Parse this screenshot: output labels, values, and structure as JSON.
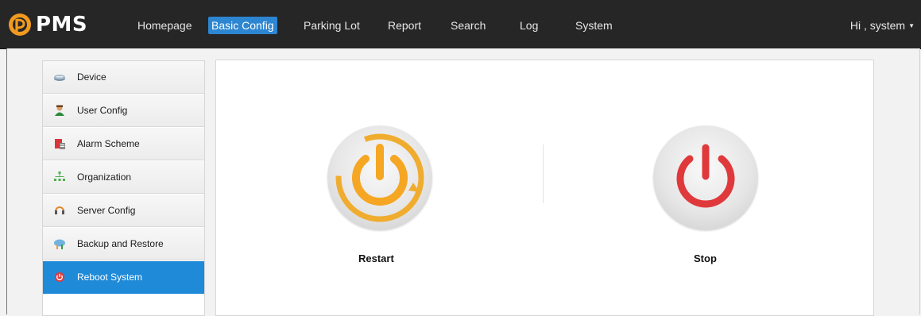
{
  "app": {
    "logo_text": "PMS"
  },
  "nav": {
    "items": [
      {
        "label": "Homepage"
      },
      {
        "label": "Basic Config"
      },
      {
        "label": "Parking Lot"
      },
      {
        "label": "Report"
      },
      {
        "label": "Search"
      },
      {
        "label": "Log"
      },
      {
        "label": "System"
      }
    ],
    "active": "Basic Config",
    "user_greeting": "Hi , system",
    "user_menu_icon": "caret-down-icon"
  },
  "sidebar": {
    "items": [
      {
        "label": "Device",
        "icon": "device-icon"
      },
      {
        "label": "User Config",
        "icon": "user-icon"
      },
      {
        "label": "Alarm Scheme",
        "icon": "alarm-icon"
      },
      {
        "label": "Organization",
        "icon": "organization-icon"
      },
      {
        "label": "Server Config",
        "icon": "server-icon"
      },
      {
        "label": "Backup and Restore",
        "icon": "backup-icon"
      },
      {
        "label": "Reboot System",
        "icon": "power-icon"
      }
    ],
    "active": "Reboot System"
  },
  "main": {
    "restart_label": "Restart",
    "stop_label": "Stop"
  },
  "colors": {
    "topbar": "#262626",
    "accent_blue": "#2d86d1",
    "restart_orange": "#f5a623",
    "stop_red": "#e0393b"
  }
}
